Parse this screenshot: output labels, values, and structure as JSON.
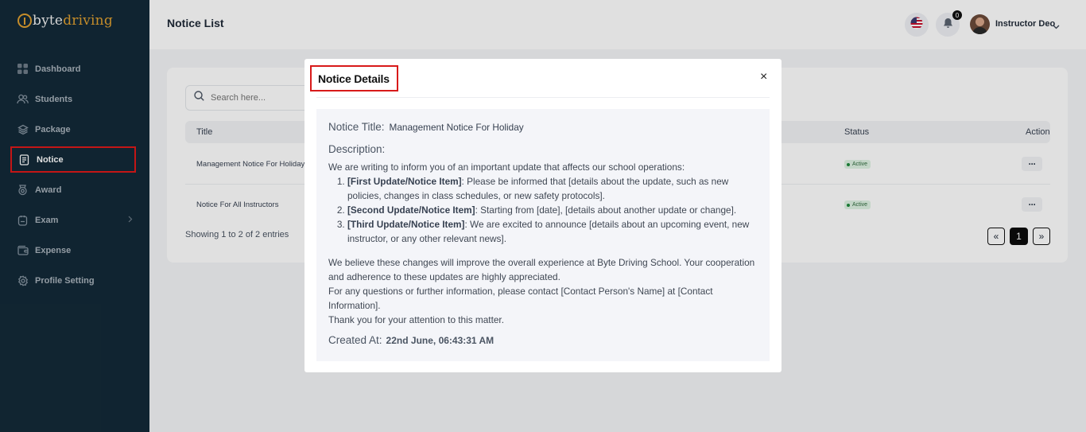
{
  "brand": {
    "part1": "byte",
    "part2": "driving"
  },
  "sidebar": {
    "items": [
      {
        "label": "Dashboard",
        "icon": "grid-icon"
      },
      {
        "label": "Students",
        "icon": "users-icon"
      },
      {
        "label": "Package",
        "icon": "layers-icon"
      },
      {
        "label": "Notice",
        "icon": "document-icon",
        "active": true
      },
      {
        "label": "Award",
        "icon": "award-icon"
      },
      {
        "label": "Exam",
        "icon": "exam-icon",
        "has_submenu": true
      },
      {
        "label": "Expense",
        "icon": "wallet-icon"
      },
      {
        "label": "Profile Setting",
        "icon": "gear-icon"
      }
    ]
  },
  "header": {
    "title": "Notice List",
    "notification_count": "0",
    "user_name": "Instructor Deo"
  },
  "list": {
    "search_placeholder": "Search here...",
    "columns": {
      "title": "Title",
      "status": "Status",
      "action": "Action"
    },
    "rows": [
      {
        "title": "Management Notice For Holiday",
        "status": "Active"
      },
      {
        "title": "Notice For All Instructors",
        "status": "Active"
      }
    ],
    "entries_text": "Showing 1 to 2 of 2 entries",
    "pagination": {
      "prev": "«",
      "current": "1",
      "next": "»"
    }
  },
  "modal": {
    "heading": "Notice Details",
    "close": "×",
    "title_label": "Notice Title:",
    "title_value": "Management Notice For Holiday",
    "description_label": "Description:",
    "intro": "We are writing to inform you of an important update that affects our school operations:",
    "items": [
      {
        "bold": "[First Update/Notice Item]",
        "text": ": Please be informed that [details about the update, such as new policies, changes in class schedules, or new safety protocols]."
      },
      {
        "bold": "[Second Update/Notice Item]",
        "text": ": Starting from [date], [details about another update or change]."
      },
      {
        "bold": "[Third Update/Notice Item]",
        "text": ": We are excited to announce [details about an upcoming event, new instructor, or any other relevant news]."
      }
    ],
    "para1": "We believe these changes will improve the overall experience at Byte Driving School. Your cooperation and adherence to these updates are highly appreciated.",
    "para2": "For any questions or further information, please contact [Contact Person's Name] at [Contact Information].",
    "para3": "Thank you for your attention to this matter.",
    "created_label": "Created At:",
    "created_value": "22nd June, 06:43:31 AM"
  },
  "colors": {
    "sidebar_bg": "#132a38",
    "brand_accent": "#e0a030",
    "highlight_border": "#e01a1a",
    "status_green": "#1e8a3c"
  }
}
